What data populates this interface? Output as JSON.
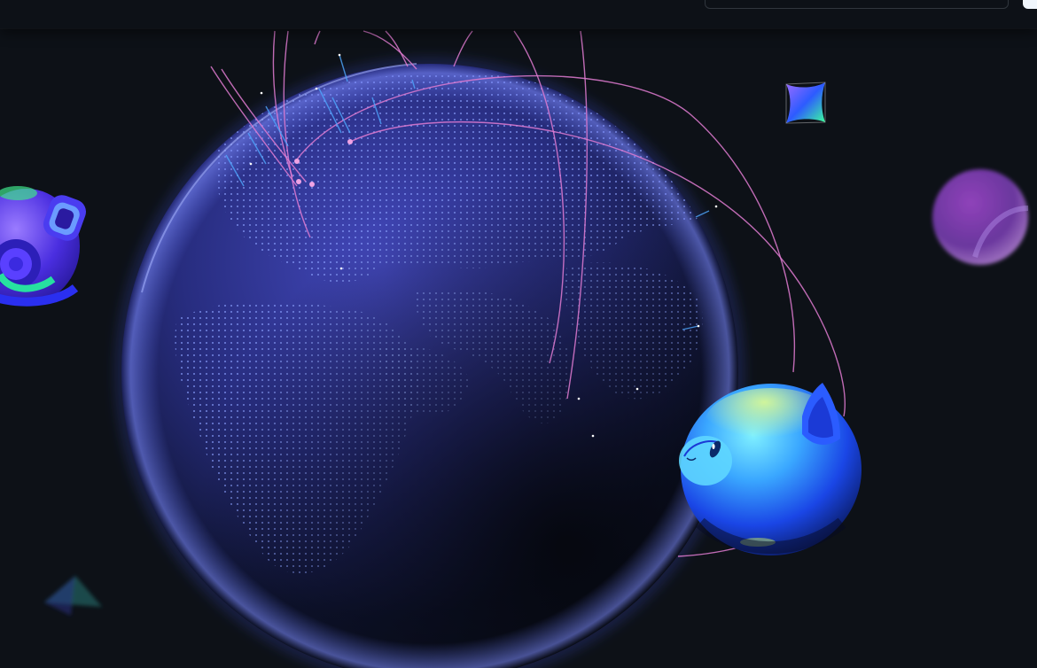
{
  "header": {
    "search": {
      "value": "",
      "placeholder": ""
    }
  },
  "scene": {
    "background_color": "#0d1117",
    "globe_colors": {
      "rim": "#5b6cff",
      "dots": "#8aa0ff",
      "arcs": "#e07bd1"
    },
    "mascots": [
      "octocat-helmet-icon",
      "mona-cat-sphere-icon",
      "purple-bubble-icon",
      "gem-diamond-icon",
      "pyramid-icon"
    ]
  }
}
